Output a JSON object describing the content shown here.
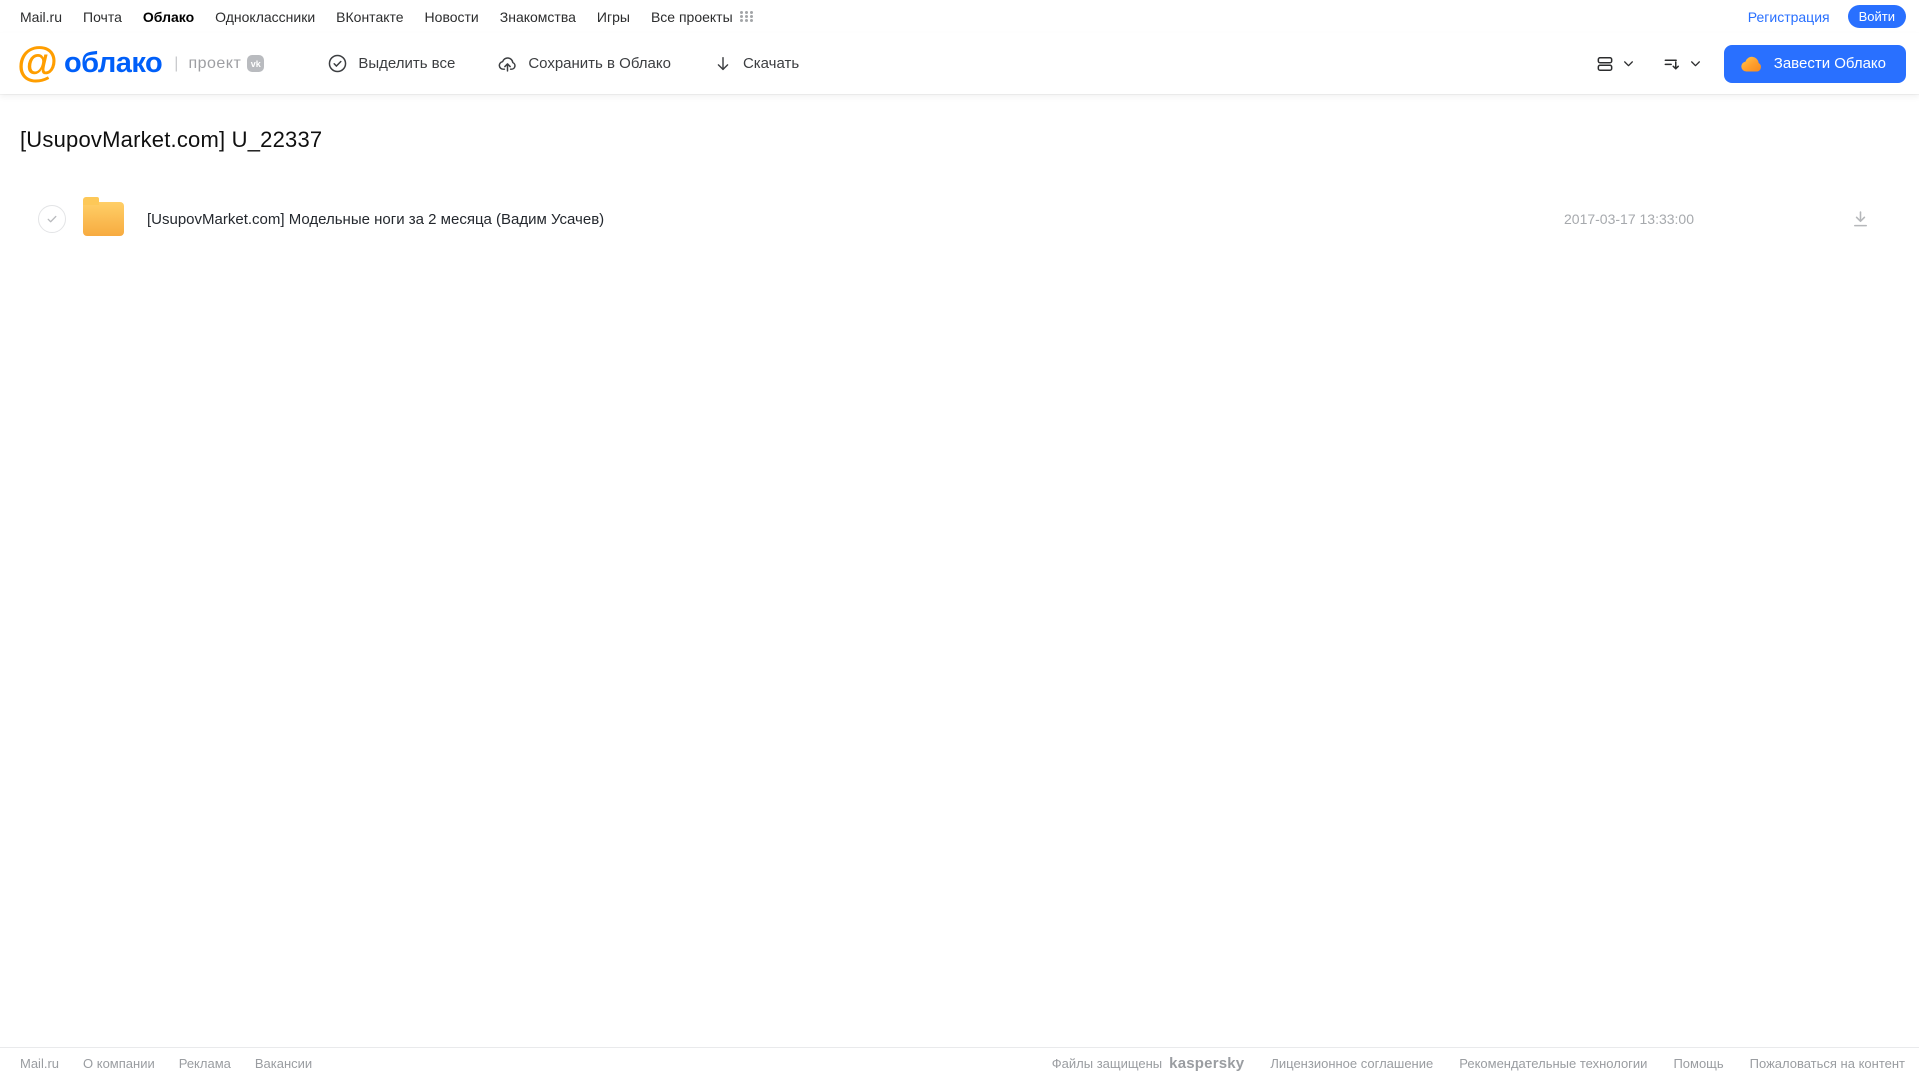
{
  "portal_nav": {
    "links": [
      "Mail.ru",
      "Почта",
      "Облако",
      "Одноклассники",
      "ВКонтакте",
      "Новости",
      "Знакомства",
      "Игры",
      "Все проекты"
    ],
    "active_link": "Облако",
    "registration_label": "Регистрация",
    "login_label": "Войти"
  },
  "header": {
    "logo_word": "облако",
    "logo_at": "@",
    "project_label": "проект",
    "vk_badge": "vk",
    "toolbar": {
      "select_all_label": "Выделить все",
      "save_to_cloud_label": "Сохранить в Облако",
      "download_label": "Скачать"
    },
    "get_cloud_label": "Завести Облако"
  },
  "main": {
    "page_title": "[UsupovMarket.com] U_22337",
    "files": [
      {
        "type": "folder",
        "name": "[UsupovMarket.com] Модельные ноги за 2 месяца (Вадим Усачев)",
        "date": "2017-03-17 13:33:00"
      }
    ]
  },
  "footer": {
    "left_links": [
      "Mail.ru",
      "О компании",
      "Реклама",
      "Вакансии"
    ],
    "protected_label": "Файлы защищены",
    "kaspersky_label": "kaspersky",
    "right_links": [
      "Лицензионное соглашение",
      "Рекомендательные технологии",
      "Помощь",
      "Пожаловаться на контент"
    ]
  },
  "colors": {
    "accent_blue": "#2970ff",
    "logo_blue": "#005ff9",
    "logo_orange": "#ff9e00",
    "folder_yellow": "#f9b94c",
    "kaspersky_green": "#009982"
  }
}
